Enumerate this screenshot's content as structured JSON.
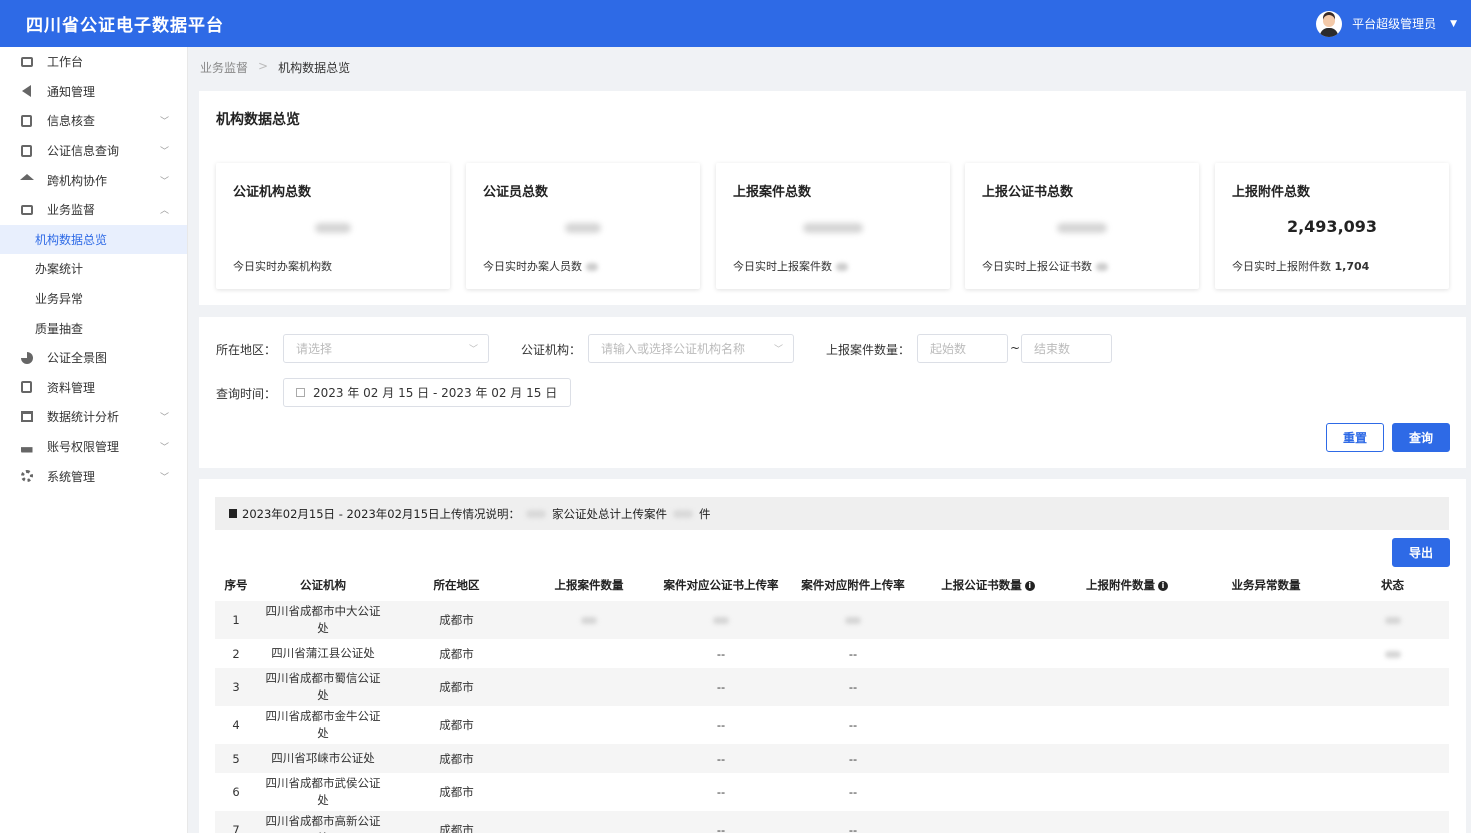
{
  "header": {
    "title": "四川省公证电子数据平台",
    "user_name": "平台超级管理员"
  },
  "sidebar": {
    "items": [
      {
        "label": "工作台",
        "icon": "monitor-icon",
        "expandable": false
      },
      {
        "label": "通知管理",
        "icon": "megaphone-icon",
        "expandable": false
      },
      {
        "label": "信息核查",
        "icon": "search-doc-icon",
        "expandable": true
      },
      {
        "label": "公证信息查询",
        "icon": "query-doc-icon",
        "expandable": true
      },
      {
        "label": "跨机构协作",
        "icon": "institution-icon",
        "expandable": true
      },
      {
        "label": "业务监督",
        "icon": "briefcase-icon",
        "expandable": true,
        "expanded": true
      },
      {
        "label": "公证全景图",
        "icon": "pie-chart-icon",
        "expandable": false
      },
      {
        "label": "资料管理",
        "icon": "file-icon",
        "expandable": false
      },
      {
        "label": "数据统计分析",
        "icon": "bar-chart-icon",
        "expandable": true
      },
      {
        "label": "账号权限管理",
        "icon": "user-icon",
        "expandable": true
      },
      {
        "label": "系统管理",
        "icon": "gear-icon",
        "expandable": true
      }
    ],
    "sub_items": [
      "机构数据总览",
      "办案统计",
      "业务异常",
      "质量抽查"
    ]
  },
  "breadcrumb": {
    "parent": "业务监督",
    "current": "机构数据总览"
  },
  "overview": {
    "title": "机构数据总览",
    "cards": [
      {
        "label": "公证机构总数",
        "value": "",
        "sub_label": "今日实时办案机构数",
        "sub_value": ""
      },
      {
        "label": "公证员总数",
        "value": "",
        "sub_label": "今日实时办案人员数",
        "sub_value": ""
      },
      {
        "label": "上报案件总数",
        "value": "",
        "sub_label": "今日实时上报案件数",
        "sub_value": ""
      },
      {
        "label": "上报公证书总数",
        "value": "",
        "sub_label": "今日实时上报公证书数",
        "sub_value": ""
      },
      {
        "label": "上报附件总数",
        "value": "2,493,093",
        "sub_label": "今日实时上报附件数",
        "sub_value": "1,704"
      }
    ]
  },
  "filters": {
    "region_label": "所在地区：",
    "region_placeholder": "请选择",
    "org_label": "公证机构：",
    "org_placeholder": "请输入或选择公证机构名称",
    "count_label": "上报案件数量：",
    "count_start_placeholder": "起始数",
    "count_tilde": "~",
    "count_end_placeholder": "结束数",
    "time_label": "查询时间：",
    "date_range": "2023 年 02 月 15 日  -  2023 年 02 月 15 日",
    "reset_label": "重置",
    "query_label": "查询"
  },
  "table": {
    "notice_prefix": "2023年02月15日 - 2023年02月15日上传情况说明：",
    "notice_mid": "家公证处总计上传案件",
    "notice_suffix": "件",
    "export_label": "导出",
    "columns": [
      "序号",
      "公证机构",
      "所在地区",
      "上报案件数量",
      "案件对应公证书上传率",
      "案件对应附件上传率",
      "上报公证书数量",
      "上报附件数量",
      "业务异常数量",
      "状态"
    ],
    "rows": [
      {
        "no": "1",
        "org_line1": "四川省成都市中大公证",
        "org_line2": "处",
        "region": "成都市",
        "cert_rate": "",
        "att_rate": ""
      },
      {
        "no": "2",
        "org_line1": "四川省蒲江县公证处",
        "org_line2": "",
        "region": "成都市",
        "cert_rate": "--",
        "att_rate": "--"
      },
      {
        "no": "3",
        "org_line1": "四川省成都市蜀信公证",
        "org_line2": "处",
        "region": "成都市",
        "cert_rate": "--",
        "att_rate": "--"
      },
      {
        "no": "4",
        "org_line1": "四川省成都市金牛公证",
        "org_line2": "处",
        "region": "成都市",
        "cert_rate": "--",
        "att_rate": "--"
      },
      {
        "no": "5",
        "org_line1": "四川省邛崃市公证处",
        "org_line2": "",
        "region": "成都市",
        "cert_rate": "--",
        "att_rate": "--"
      },
      {
        "no": "6",
        "org_line1": "四川省成都市武侯公证",
        "org_line2": "处",
        "region": "成都市",
        "cert_rate": "--",
        "att_rate": "--"
      },
      {
        "no": "7",
        "org_line1": "四川省成都市高新公证",
        "org_line2": "处",
        "region": "成都市",
        "cert_rate": "--",
        "att_rate": "--"
      }
    ]
  }
}
